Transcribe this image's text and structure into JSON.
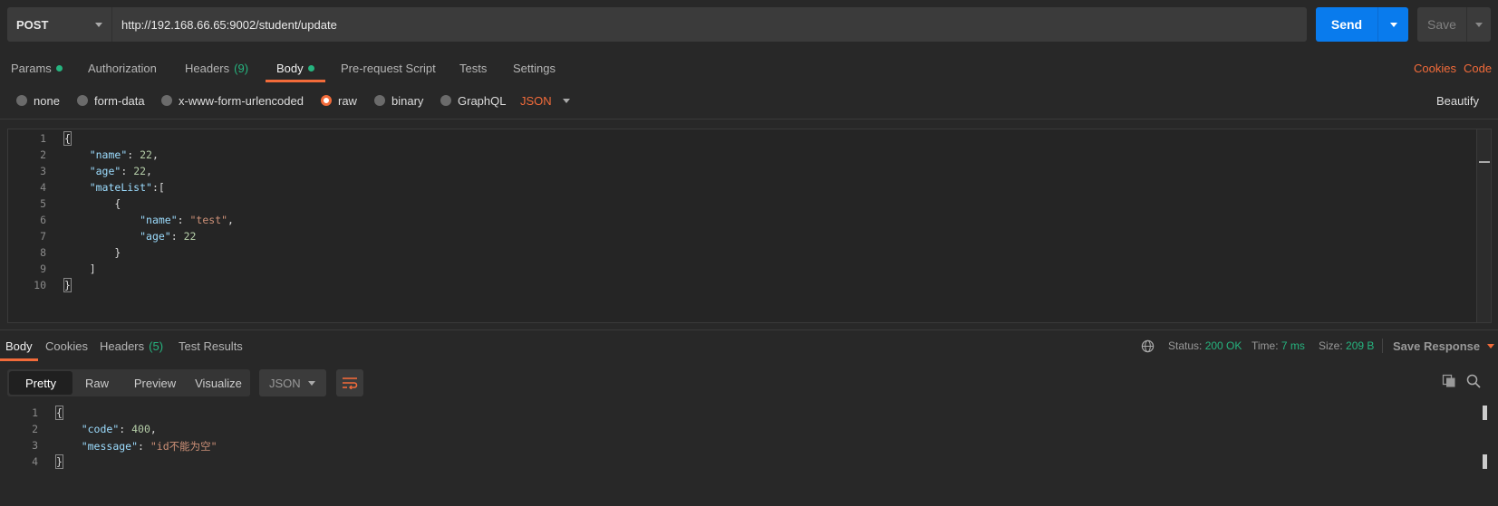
{
  "request": {
    "method": "POST",
    "url": "http://192.168.66.65:9002/student/update",
    "send_label": "Send",
    "save_label": "Save"
  },
  "tabs": {
    "params": "Params",
    "authorization": "Authorization",
    "headers": "Headers",
    "headers_count": "(9)",
    "body": "Body",
    "prerequest": "Pre-request Script",
    "tests": "Tests",
    "settings": "Settings",
    "cookies": "Cookies",
    "code": "Code"
  },
  "body_types": {
    "none": "none",
    "form_data": "form-data",
    "urlencoded": "x-www-form-urlencoded",
    "raw": "raw",
    "binary": "binary",
    "graphql": "GraphQL",
    "selected_language": "JSON",
    "beautify": "Beautify"
  },
  "request_body": {
    "line_numbers": [
      "1",
      "2",
      "3",
      "4",
      "5",
      "6",
      "7",
      "8",
      "9",
      "10"
    ]
  },
  "response": {
    "tabs": {
      "body": "Body",
      "cookies": "Cookies",
      "headers": "Headers",
      "headers_count": "(5)",
      "test_results": "Test Results"
    },
    "status_label": "Status:",
    "status_value": "200 OK",
    "time_label": "Time:",
    "time_value": "7 ms",
    "size_label": "Size:",
    "size_value": "209 B",
    "save_response": "Save Response",
    "views": {
      "pretty": "Pretty",
      "raw": "Raw",
      "preview": "Preview",
      "visualize": "Visualize"
    },
    "format": "JSON",
    "line_numbers": [
      "1",
      "2",
      "3",
      "4"
    ]
  },
  "colors": {
    "accent": "#f26b3a",
    "send": "#097bed",
    "success": "#26b47f",
    "background": "#282828"
  }
}
